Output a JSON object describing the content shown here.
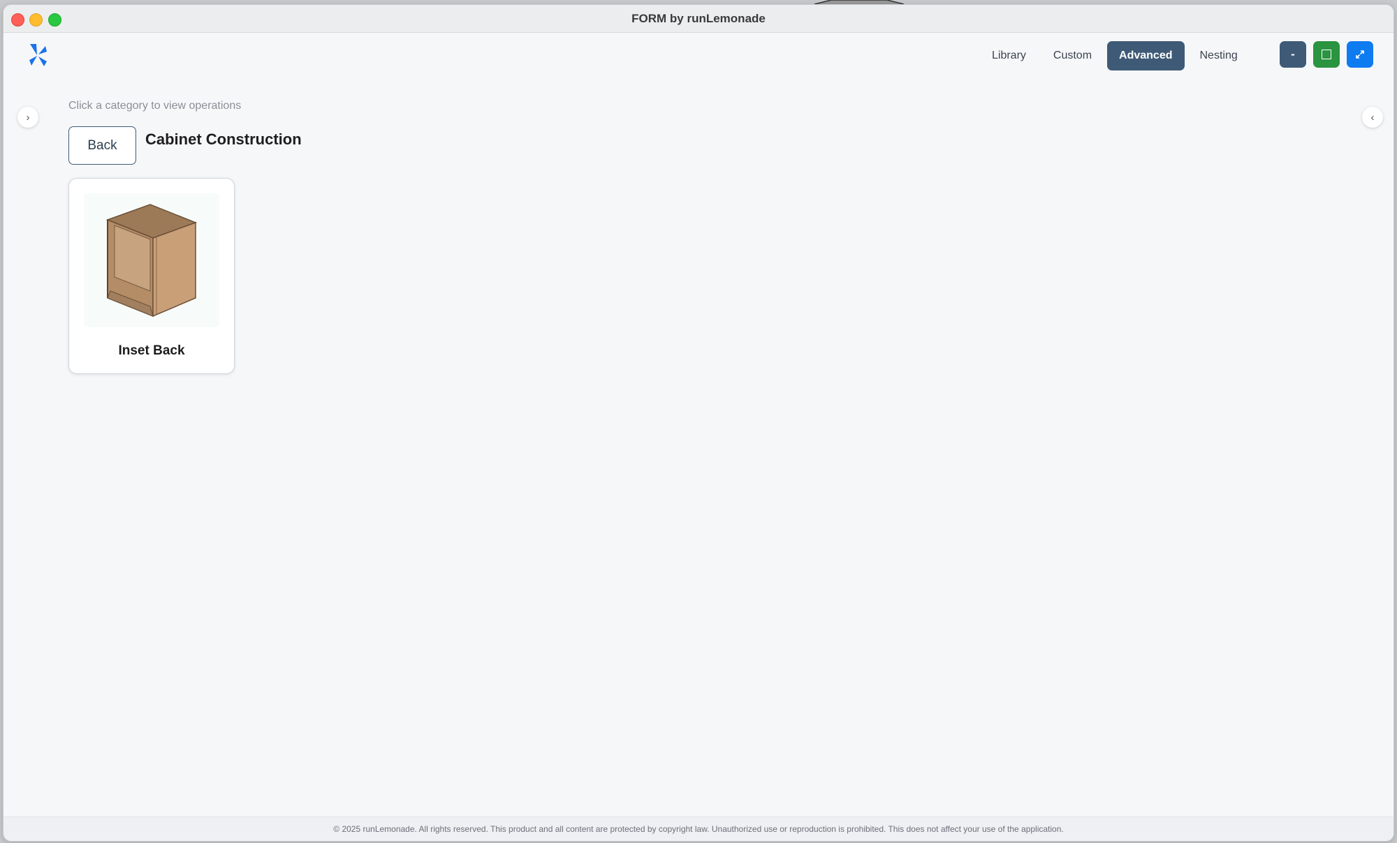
{
  "window": {
    "title": "FORM by runLemonade"
  },
  "nav": {
    "tabs": [
      {
        "label": "Library",
        "active": false
      },
      {
        "label": "Custom",
        "active": false
      },
      {
        "label": "Advanced",
        "active": true
      },
      {
        "label": "Nesting",
        "active": false
      }
    ]
  },
  "window_controls": {
    "minimize_label": "-",
    "square_icon": "square-icon",
    "expand_icon": "expand-icon"
  },
  "sidebar": {
    "left_toggle_glyph": "›",
    "right_toggle_glyph": "‹"
  },
  "main": {
    "hint": "Click a category to view operations",
    "back_label": "Back",
    "section_title": "Cabinet Construction",
    "cards": [
      {
        "label": "Inset Back",
        "icon": "cabinet-box-icon"
      }
    ]
  },
  "footer": {
    "text": "© 2025 runLemonade. All rights reserved. This product and all content are protected by copyright law. Unauthorized use or reproduction is prohibited. This does not affect your use of the application."
  },
  "colors": {
    "accent": "#3e5a76",
    "green": "#2a9440",
    "blue": "#0f7bf0",
    "logo": "#1a73e8"
  }
}
